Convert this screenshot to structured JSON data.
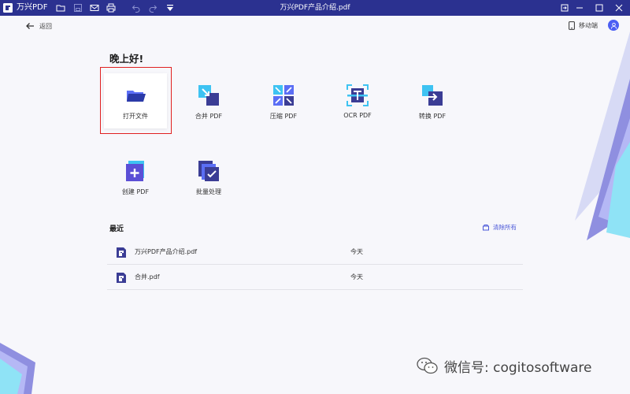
{
  "titlebar": {
    "app_name": "万兴PDF",
    "doc_title": "万兴PDF产品介绍.pdf"
  },
  "header": {
    "back_label": "返回",
    "mobile_label": "移动端"
  },
  "greeting": "晚上好!",
  "tools": [
    {
      "label": "打开文件",
      "icon": "folder-open-icon"
    },
    {
      "label": "合并 PDF",
      "icon": "merge-icon"
    },
    {
      "label": "压缩 PDF",
      "icon": "compress-icon"
    },
    {
      "label": "OCR PDF",
      "icon": "ocr-icon"
    },
    {
      "label": "转换 PDF",
      "icon": "convert-icon"
    },
    {
      "label": "创建 PDF",
      "icon": "create-icon"
    },
    {
      "label": "批量处理",
      "icon": "batch-icon"
    }
  ],
  "recent": {
    "title": "最近",
    "clear_label": "清除所有",
    "files": [
      {
        "name": "万兴PDF产品介绍.pdf",
        "date": "今天"
      },
      {
        "name": "合并.pdf",
        "date": "今天"
      }
    ]
  },
  "watermark": "微信号: cogitosoftware",
  "colors": {
    "titlebar": "#2b3190",
    "accent": "#4b5ef3",
    "highlight": "#e02020"
  }
}
